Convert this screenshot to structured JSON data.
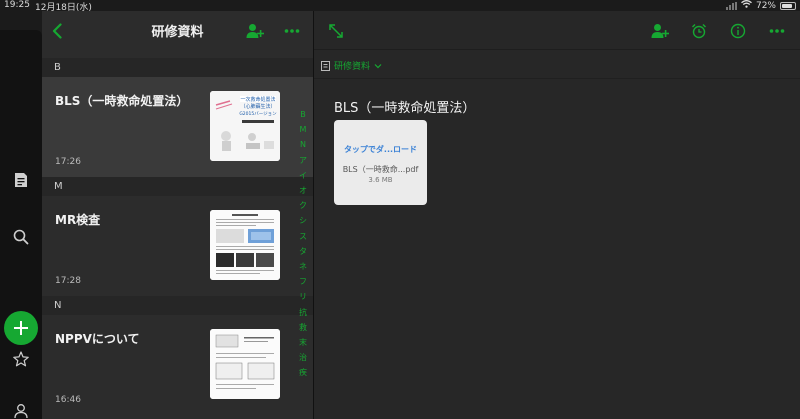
{
  "status_bar": {
    "time": "19:25",
    "date": "12月18日(水)",
    "battery": "72%"
  },
  "list": {
    "title": "研修資料",
    "sections": [
      {
        "letter": "B",
        "notes": [
          {
            "title": "BLS（一時救命処置法）",
            "time": "17:26",
            "selected": true
          }
        ]
      },
      {
        "letter": "M",
        "notes": [
          {
            "title": "MR検査",
            "time": "17:28",
            "selected": false
          }
        ]
      },
      {
        "letter": "N",
        "notes": [
          {
            "title": "NPPVについて",
            "time": "16:46",
            "selected": false
          }
        ]
      }
    ],
    "alpha_index": [
      "B",
      "M",
      "N",
      "ア",
      "イ",
      "オ",
      "ク",
      "シ",
      "ス",
      "タ",
      "ネ",
      "フ",
      "リ",
      "抗",
      "救",
      "末",
      "治",
      "疾"
    ]
  },
  "thumbnails": {
    "bls": {
      "line1": "一次救命処置法",
      "line2": "（心肺蘇生法）",
      "line3": "G2015バージョン"
    }
  },
  "detail": {
    "notebook": "研修資料",
    "note_title": "BLS（一時救命処置法）",
    "attachment": {
      "tap_label": "タップでダ...ロード",
      "file_name": "BLS（一時救命...pdf",
      "file_size": "3.6 MB"
    }
  },
  "colors": {
    "accent": "#16a832",
    "link": "#3b82d6"
  },
  "icons": [
    "back-icon",
    "add-user-icon",
    "more-icon",
    "expand-icon",
    "alarm-icon",
    "info-icon",
    "notes-icon",
    "search-icon",
    "plus-icon",
    "star-icon",
    "account-icon",
    "notebook-icon",
    "chevron-down-icon",
    "wifi-icon",
    "signal-icon",
    "battery-icon"
  ]
}
